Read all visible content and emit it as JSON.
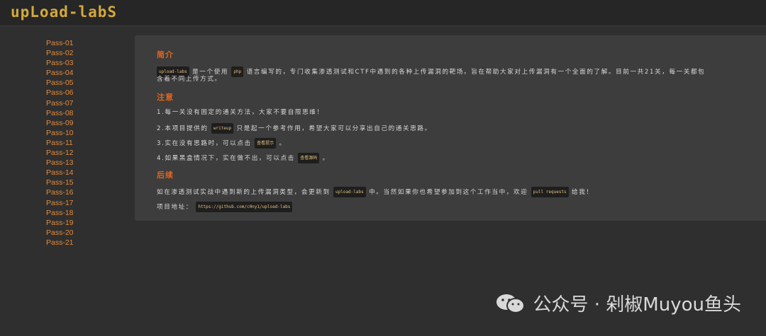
{
  "header": {
    "logo_text": "upLoad-labS"
  },
  "sidebar": {
    "items": [
      {
        "label": "Pass-01"
      },
      {
        "label": "Pass-02"
      },
      {
        "label": "Pass-03"
      },
      {
        "label": "Pass-04"
      },
      {
        "label": "Pass-05"
      },
      {
        "label": "Pass-06"
      },
      {
        "label": "Pass-07"
      },
      {
        "label": "Pass-08"
      },
      {
        "label": "Pass-09"
      },
      {
        "label": "Pass-10"
      },
      {
        "label": "Pass-11"
      },
      {
        "label": "Pass-12"
      },
      {
        "label": "Pass-13"
      },
      {
        "label": "Pass-14"
      },
      {
        "label": "Pass-15"
      },
      {
        "label": "Pass-16"
      },
      {
        "label": "Pass-17"
      },
      {
        "label": "Pass-18"
      },
      {
        "label": "Pass-19"
      },
      {
        "label": "Pass-20"
      },
      {
        "label": "Pass-21"
      }
    ]
  },
  "intro": {
    "heading": "简介",
    "code_name": "upload-labs",
    "text_a": "是一个使用",
    "code_php": "php",
    "text_b": "语言编写的，专门收集渗透测试和CTF中遇到的各种上传漏洞的靶场。旨在帮助大家对上传漏洞有一个全面的了解。目前一共21关，每一关都包",
    "line2": "含着不同上传方式。"
  },
  "notes": {
    "heading": "注意",
    "n1": "1.每一关没有固定的通关方法，大家不要自限思维！",
    "n2_a": "2.本项目提供的",
    "n2_code": "writeup",
    "n2_b": "只是起一个参考作用，希望大家可以分享出自己的通关思路。",
    "n3_a": "3.实在没有思路时，可以点击",
    "n3_link": "查看提示",
    "n3_b": "。",
    "n4_a": "4.如果黑盒情况下，实在做不出，可以点击",
    "n4_link": "查看源码",
    "n4_b": "。"
  },
  "followup": {
    "heading": "后续",
    "text_a": "如在渗透测试实战中遇到新的上传漏洞类型，会更新到",
    "code_name": "upload-labs",
    "text_b": "中。当然如果你也希望参加到这个工作当中，欢迎",
    "code_pr": "pull requests",
    "text_c": "给我！",
    "addr_label": "项目地址：",
    "addr_value": "https://github.com/c0ny1/upload-labs"
  },
  "watermark": {
    "text": "公众号 · 剁椒Muyou鱼头",
    "icon": "wechat-icon"
  },
  "colors": {
    "background": "#2f2f2f",
    "panel": "#3d3d3d",
    "logo": "#d4a93b",
    "sidebar_link": "#e48a3a",
    "heading": "#e4651d",
    "code_text": "#e6c07b"
  }
}
